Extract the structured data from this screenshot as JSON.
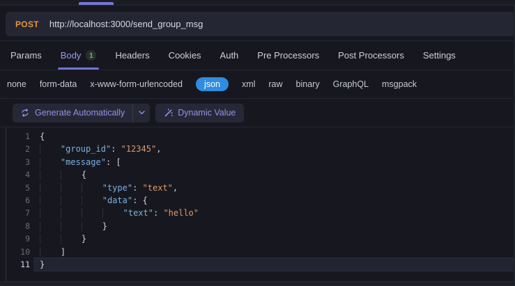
{
  "request_bar": {
    "method": "POST",
    "url": "http://localhost:3000/send_group_msg"
  },
  "tabs": {
    "items": [
      {
        "label": "Params"
      },
      {
        "label": "Body",
        "badge": "1",
        "active": true
      },
      {
        "label": "Headers"
      },
      {
        "label": "Cookies"
      },
      {
        "label": "Auth"
      },
      {
        "label": "Pre Processors"
      },
      {
        "label": "Post Processors"
      },
      {
        "label": "Settings"
      }
    ]
  },
  "body_types": {
    "options": [
      "none",
      "form-data",
      "x-www-form-urlencoded",
      "json",
      "xml",
      "raw",
      "binary",
      "GraphQL",
      "msgpack"
    ],
    "selected": "json"
  },
  "toolbar": {
    "generate_label": "Generate Automatically",
    "dynamic_value_label": "Dynamic Value"
  },
  "editor": {
    "language": "json",
    "active_line": 11,
    "lines": [
      {
        "n": 1,
        "indent": 0,
        "tokens": [
          [
            "p",
            "{"
          ]
        ]
      },
      {
        "n": 2,
        "indent": 1,
        "tokens": [
          [
            "k",
            "\"group_id\""
          ],
          [
            "p",
            ": "
          ],
          [
            "s",
            "\"12345\""
          ],
          [
            "p",
            ","
          ]
        ]
      },
      {
        "n": 3,
        "indent": 1,
        "tokens": [
          [
            "k",
            "\"message\""
          ],
          [
            "p",
            ": ["
          ]
        ]
      },
      {
        "n": 4,
        "indent": 2,
        "tokens": [
          [
            "p",
            "{"
          ]
        ]
      },
      {
        "n": 5,
        "indent": 3,
        "tokens": [
          [
            "k",
            "\"type\""
          ],
          [
            "p",
            ": "
          ],
          [
            "s",
            "\"text\""
          ],
          [
            "p",
            ","
          ]
        ]
      },
      {
        "n": 6,
        "indent": 3,
        "tokens": [
          [
            "k",
            "\"data\""
          ],
          [
            "p",
            ": {"
          ]
        ]
      },
      {
        "n": 7,
        "indent": 4,
        "tokens": [
          [
            "k",
            "\"text\""
          ],
          [
            "p",
            ": "
          ],
          [
            "s",
            "\"hello\""
          ]
        ]
      },
      {
        "n": 8,
        "indent": 3,
        "tokens": [
          [
            "p",
            "}"
          ]
        ]
      },
      {
        "n": 9,
        "indent": 2,
        "tokens": [
          [
            "p",
            "}"
          ]
        ]
      },
      {
        "n": 10,
        "indent": 1,
        "tokens": [
          [
            "p",
            "]"
          ]
        ]
      },
      {
        "n": 11,
        "indent": 0,
        "tokens": [
          [
            "p",
            "}"
          ]
        ]
      }
    ]
  },
  "colors": {
    "accent_purple": "#7173d2",
    "method_orange": "#e5953f",
    "selected_pill_blue": "#2f8ce2",
    "badge_green": "#55c16c",
    "code_key_blue": "#7bb0e3",
    "code_string_orange": "#dd9b6c"
  }
}
